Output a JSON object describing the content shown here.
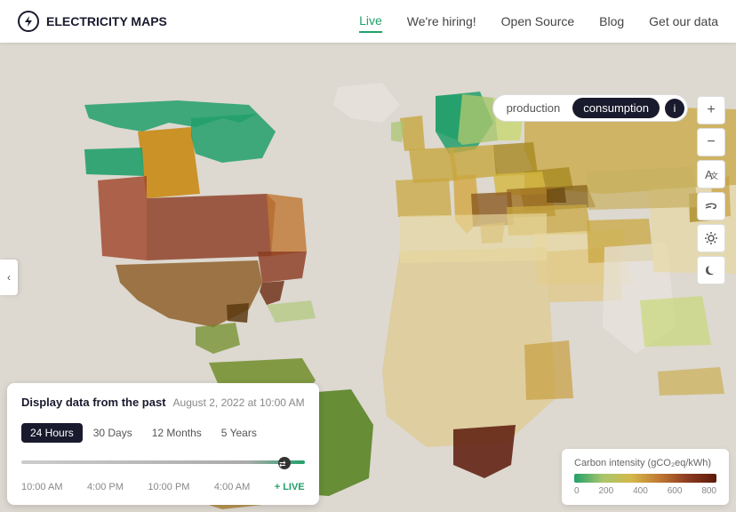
{
  "header": {
    "logo_text": "ELECTRICITY MAPS",
    "logo_icon": "⚡",
    "nav_items": [
      {
        "label": "Live",
        "active": true
      },
      {
        "label": "We're hiring!",
        "active": false
      },
      {
        "label": "Open Source",
        "active": false
      },
      {
        "label": "Blog",
        "active": false
      },
      {
        "label": "Get our data",
        "active": false
      }
    ]
  },
  "map": {
    "mode_options": [
      "production",
      "consumption"
    ],
    "active_mode": "consumption",
    "info_label": "i"
  },
  "controls": {
    "zoom_in": "+",
    "zoom_out": "−",
    "translate": "🌐",
    "wind": "💨",
    "solar": "☀",
    "dark": "🌙"
  },
  "bottom_panel": {
    "title": "Display data from the past",
    "date": "August 2, 2022 at 10:00 AM",
    "time_tabs": [
      "24 Hours",
      "30 Days",
      "12 Months",
      "5 Years"
    ],
    "active_tab": "24 Hours",
    "timeline_labels": [
      "10:00 AM",
      "4:00 PM",
      "10:00 PM",
      "4:00 AM"
    ],
    "live_label": "+ LIVE",
    "handle_icon": "⇄"
  },
  "legend": {
    "title": "Carbon intensity (gCO₂eq/kWh)",
    "ticks": [
      "0",
      "200",
      "400",
      "600",
      "800"
    ]
  },
  "left_panel": {
    "arrow": "‹"
  }
}
